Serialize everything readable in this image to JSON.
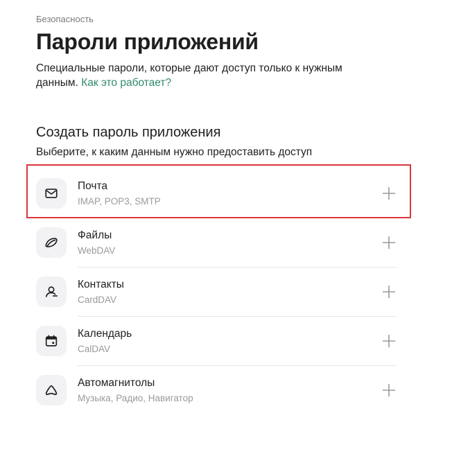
{
  "breadcrumb": "Безопасность",
  "title": "Пароли приложений",
  "description": {
    "text": "Специальные пароли, которые дают доступ только к нужным данным. ",
    "link": "Как это работает?"
  },
  "create_section": {
    "title": "Создать пароль приложения",
    "subtitle": "Выберите, к каким данным нужно предоставить доступ"
  },
  "options": [
    {
      "icon": "mail-icon",
      "title": "Почта",
      "subtitle": "IMAP, POP3, SMTP",
      "highlighted": true
    },
    {
      "icon": "files-icon",
      "title": "Файлы",
      "subtitle": "WebDAV"
    },
    {
      "icon": "contacts-icon",
      "title": "Контакты",
      "subtitle": "CardDAV"
    },
    {
      "icon": "calendar-icon",
      "title": "Календарь",
      "subtitle": "CalDAV"
    },
    {
      "icon": "car-radio-icon",
      "title": "Автомагнитолы",
      "subtitle": "Музыка, Радио, Навигатор"
    }
  ],
  "colors": {
    "link": "#2f8a6a",
    "highlight_border": "#d9363e",
    "icon_background": "#f2f2f4"
  }
}
